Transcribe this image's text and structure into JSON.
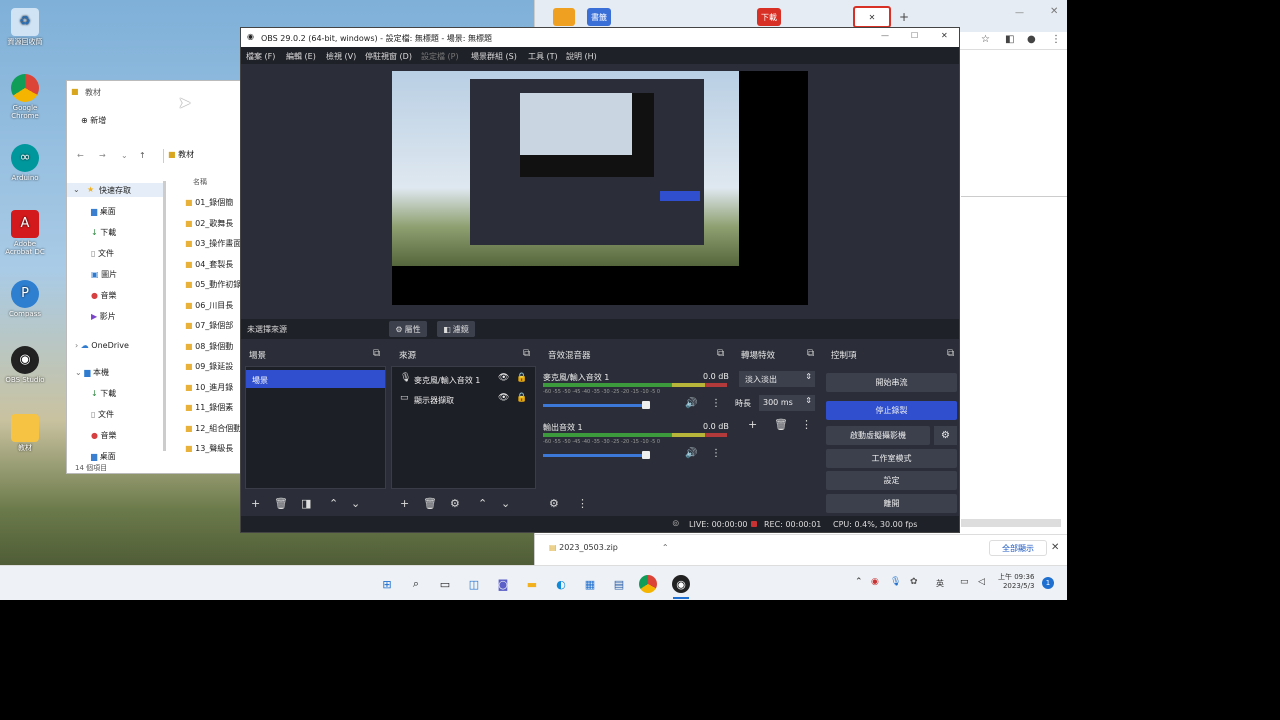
{
  "desktop": {
    "icons": [
      {
        "label": "資源回收筒",
        "icon": "recycle-bin-icon"
      },
      {
        "label": "Google Chrome",
        "icon": "chrome-icon"
      },
      {
        "label": "Arduino",
        "icon": "arduino-icon"
      },
      {
        "label": "Adobe Acrobat DC",
        "icon": "acrobat-icon"
      },
      {
        "label": "Compass",
        "icon": "compass-icon"
      },
      {
        "label": "OBS Studio",
        "icon": "obs-icon"
      },
      {
        "label": "教材",
        "icon": "folder-icon"
      }
    ]
  },
  "explorer": {
    "title": "教材",
    "new_label": "新增",
    "path": "教材",
    "column_name": "名稱",
    "nav": {
      "quick_access": "快速存取",
      "items": [
        "桌面",
        "下載",
        "文件",
        "圖片",
        "音樂",
        "影片"
      ],
      "onedrive": "OneDrive",
      "this_pc": "本機",
      "pc_items": [
        "下載",
        "文件",
        "音樂",
        "桌面"
      ]
    },
    "files": [
      "01_錄個簡",
      "02_歌舞長",
      "03_操作畫面",
      "04_套製長",
      "05_動作初錄",
      "06_川目長",
      "07_錄個部",
      "08_錄個動",
      "09_錄延設",
      "10_進月錄",
      "11_錄個素",
      "12_組合個動",
      "13_聲級長"
    ],
    "item_count": "14 個項目"
  },
  "chrome": {
    "tabs": [
      "書籤",
      "書籤",
      "下載"
    ],
    "download_file": "2023_0503.zip",
    "show_all": "全部顯示"
  },
  "obs": {
    "title": "OBS 29.0.2 (64-bit, windows) - 設定檔: 無標題 - 場景: 無標題",
    "menu": [
      "檔案 (F)",
      "編輯 (E)",
      "檢視 (V)",
      "停駐視窗 (D)",
      "設定檔 (P)",
      "場景群組 (S)",
      "工具 (T)",
      "說明 (H)"
    ],
    "no_source": "未選擇來源",
    "properties": "屬性",
    "filters": "濾鏡",
    "docks": {
      "scenes": "場景",
      "sources": "來源",
      "mixer": "音效混音器",
      "transitions": "轉場特效",
      "controls": "控制項"
    },
    "scene_item": "場景",
    "sources": [
      "麥克風/輸入音效 1",
      "顯示器擷取"
    ],
    "mixer": [
      {
        "name": "麥克風/輸入音效 1",
        "db": "0.0 dB",
        "level": 0.72
      },
      {
        "name": "輸出音效 1",
        "db": "0.0 dB",
        "level": 0.72
      }
    ],
    "meter_ticks": "-60 -55 -50 -45 -40 -35 -30 -25 -20 -15 -10 -5 0",
    "transition": {
      "type": "淡入淡出",
      "duration_label": "時長",
      "duration": "300 ms"
    },
    "controls": [
      "開始串流",
      "停止錄製",
      "啟動虛擬攝影機",
      "工作室模式",
      "設定",
      "離開"
    ],
    "status": {
      "live": "LIVE: 00:00:00",
      "rec": "REC: 00:00:01",
      "cpu": "CPU: 0.4%, 30.00 fps"
    }
  },
  "taskbar": {
    "time": "上午 09:36",
    "date": "2023/5/3",
    "ime": "英",
    "badge": "1"
  },
  "colors": {
    "obs_bg": "#2b2e38",
    "obs_accent": "#2f4fcf",
    "chrome_tab": "#e6ecf3"
  }
}
